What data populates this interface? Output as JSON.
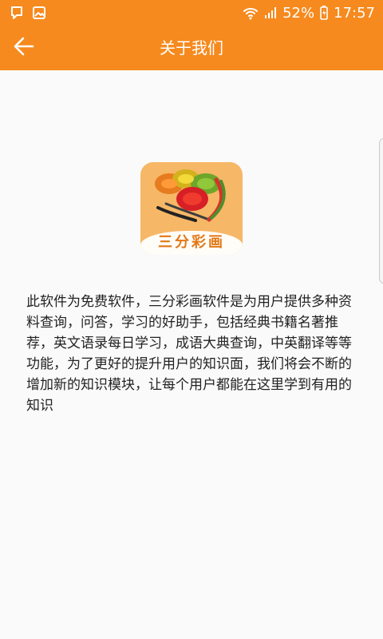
{
  "status_bar": {
    "battery_percent": "52%",
    "time": "17:57",
    "icons": [
      "screen-capture-icon",
      "image-icon",
      "wifi-icon",
      "signal-icon",
      "battery-charging-icon"
    ]
  },
  "header": {
    "title": "关于我们",
    "back_icon": "arrow-left-icon"
  },
  "logo": {
    "text": "三分彩画"
  },
  "description": "此软件为免费软件，三分彩画软件是为用户提供多种资料查询，问答，学习的好助手，包括经典书籍名著推荐，英文语录每日学习，成语大典查询，中英翻译等等功能，为了更好的提升用户的知识面，我们将会不断的增加新的知识模块，让每个用户都能在这里学到有用的知识",
  "colors": {
    "primary": "#f68a1e",
    "background": "#fafafa",
    "logo_background": "#f6b767",
    "logo_text": "#e27715"
  }
}
